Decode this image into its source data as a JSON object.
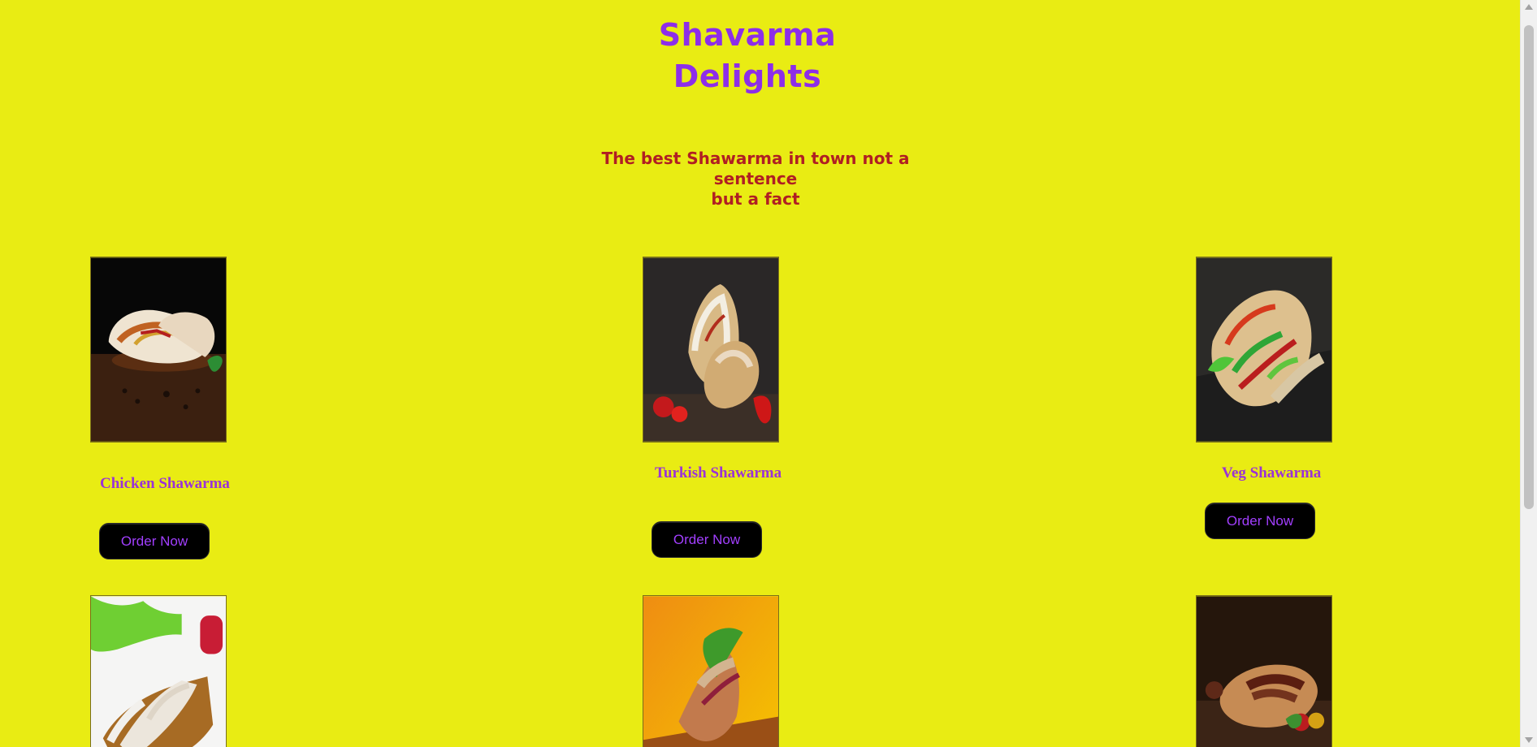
{
  "header": {
    "title_line_1": "Shavarma",
    "title_line_2": "Delights"
  },
  "tagline": {
    "line_1": "The best Shawarma in town not a sentence",
    "line_2": "but a fact"
  },
  "menu": {
    "items": [
      {
        "name": "Chicken Shawarma",
        "button_label": "Order Now"
      },
      {
        "name": "Turkish Shawarma",
        "button_label": "Order Now"
      },
      {
        "name": "Veg Shawarma",
        "button_label": "Order Now"
      }
    ]
  },
  "colors": {
    "background": "#e9ec13",
    "title": "#8d2ee8",
    "tagline": "#b01f23",
    "item_name": "#9a33d6",
    "button_bg": "#000000",
    "button_text": "#a23fff"
  },
  "icons": {
    "scroll_up": "scroll-up-arrow-icon",
    "scroll_down": "scroll-down-arrow-icon"
  }
}
